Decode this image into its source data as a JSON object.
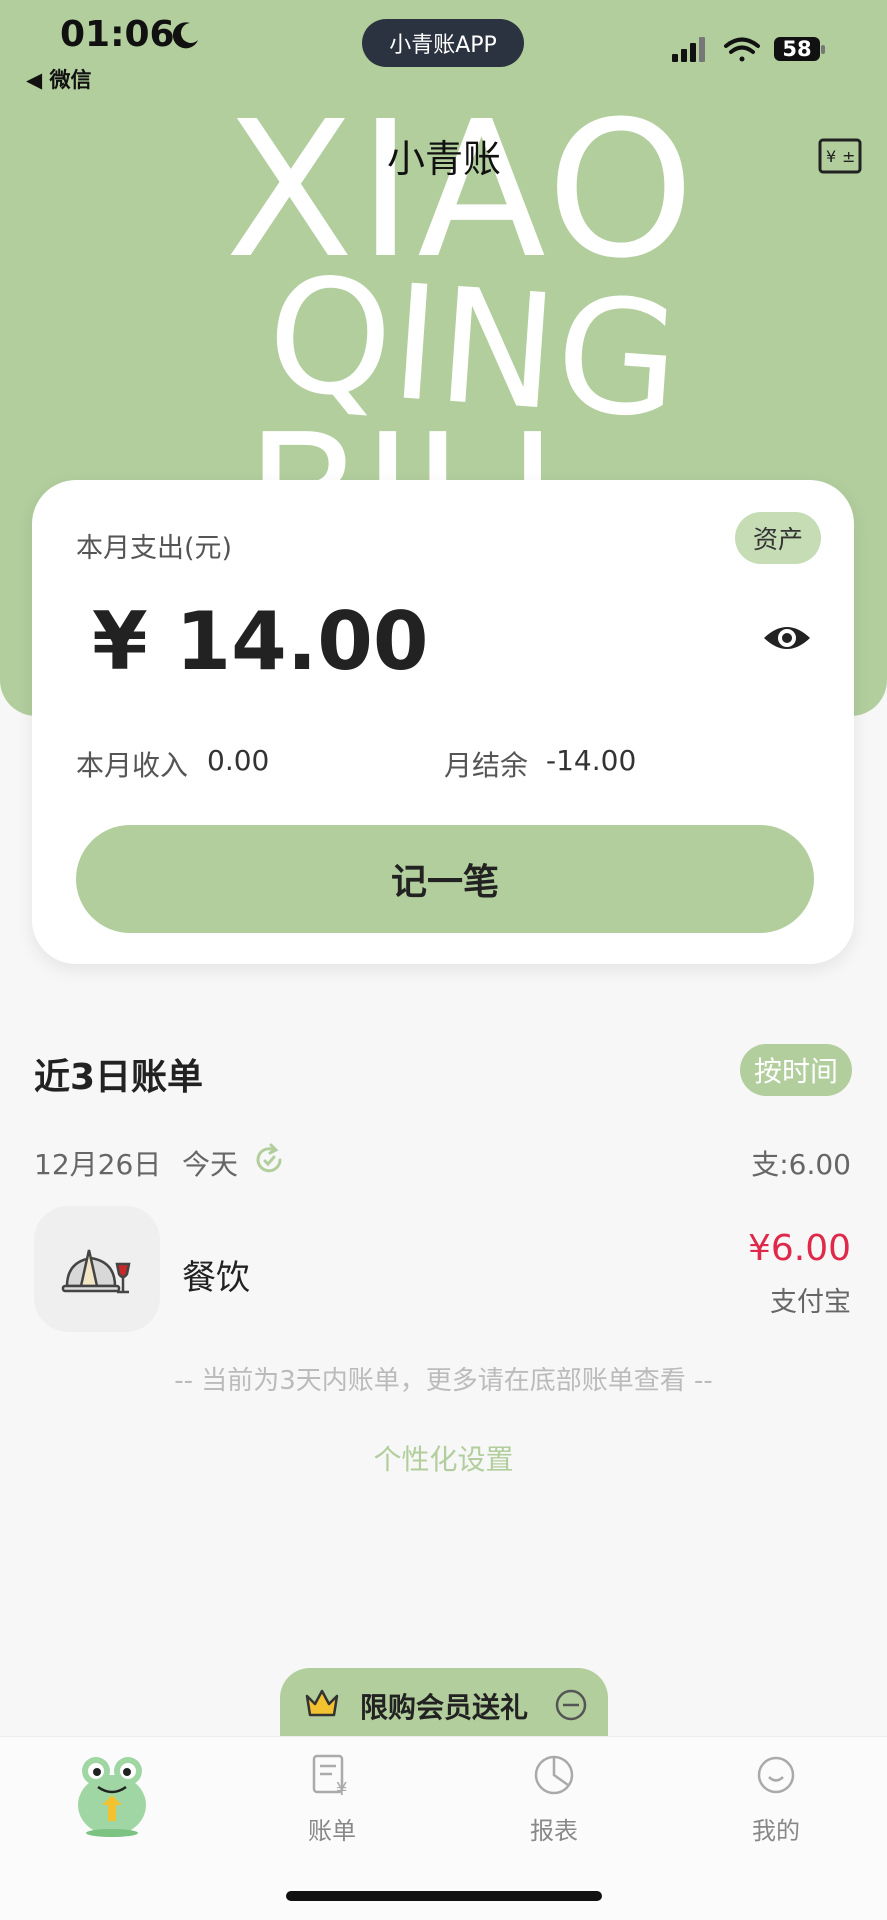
{
  "status_bar": {
    "time": "01:06",
    "back_app": "◀ 微信",
    "app_name": "小青账APP",
    "battery": "58"
  },
  "header": {
    "title": "小青账",
    "decor_letters": [
      "XIAO",
      "QING",
      "BILL"
    ]
  },
  "summary_card": {
    "label": "本月支出(元)",
    "assets_badge": "资产",
    "amount": "¥ 14.00",
    "income_label": "本月收入",
    "income_value": "0.00",
    "balance_label": "月结余",
    "balance_value": "-14.00",
    "record_button": "记一笔"
  },
  "recent_bills": {
    "title": "近3日账单",
    "sort_label": "按时间",
    "groups": [
      {
        "date": "12月26日",
        "day_label": "今天",
        "total": "支:6.00",
        "transactions": [
          {
            "category": "餐饮",
            "amount": "¥6.00",
            "method": "支付宝",
            "icon": "dining-icon"
          }
        ]
      }
    ],
    "notice": "-- 当前为3天内账单，更多请在底部账单查看 --",
    "customize_link": "个性化设置"
  },
  "promo": {
    "label": "限购会员送礼",
    "icon": "crown-icon"
  },
  "tabbar": {
    "tabs": [
      {
        "label": "",
        "icon": "frog-mascot-icon"
      },
      {
        "label": "账单",
        "icon": "bill-icon"
      },
      {
        "label": "报表",
        "icon": "pie-chart-icon"
      },
      {
        "label": "我的",
        "icon": "profile-icon"
      }
    ]
  },
  "colors": {
    "accent": "#b2ce9d",
    "expense": "#e0284a",
    "background": "#f7f7f7"
  }
}
